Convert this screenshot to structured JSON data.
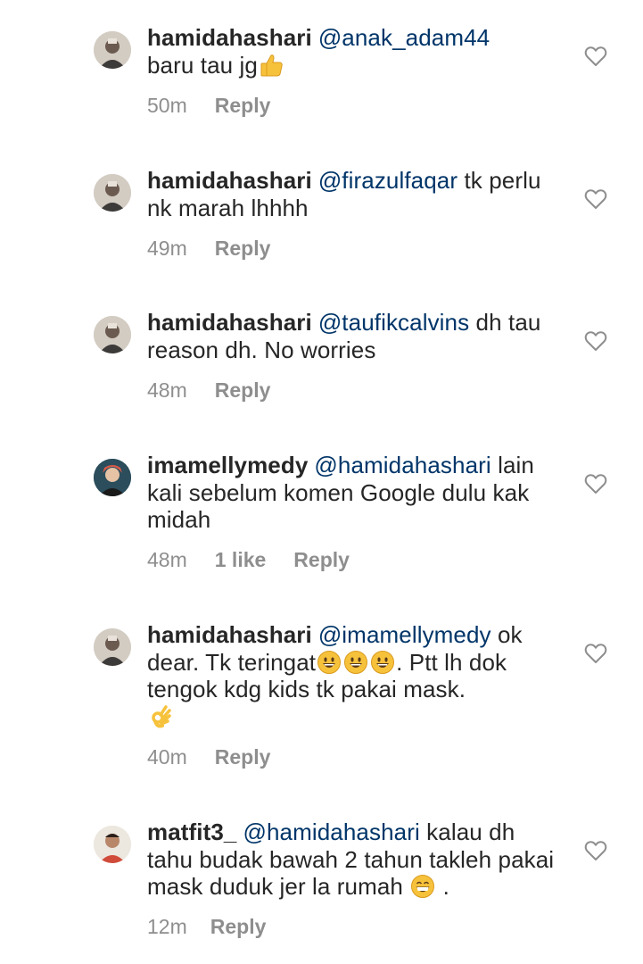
{
  "comments": [
    {
      "username": "hamidahashari",
      "mention": "@anak_adam44",
      "text_before_emoji": " baru tau jg",
      "emojis": [
        "thumbs-up"
      ],
      "text_after": "",
      "time": "50m",
      "likes": "",
      "reply": "Reply"
    },
    {
      "username": "hamidahashari",
      "mention": "@firazulfaqar",
      "text_before_emoji": " tk perlu nk marah lhhhh",
      "emojis": [],
      "text_after": "",
      "time": "49m",
      "likes": "",
      "reply": "Reply"
    },
    {
      "username": "hamidahashari",
      "mention": "@taufikcalvins",
      "text_before_emoji": " dh tau reason dh. No worries",
      "emojis": [],
      "text_after": "",
      "time": "48m",
      "likes": "",
      "reply": "Reply"
    },
    {
      "username": "imamellymedy",
      "mention": "@hamidahashari",
      "text_before_emoji": " lain kali sebelum komen Google dulu kak midah",
      "emojis": [],
      "text_after": "",
      "time": "48m",
      "likes": "1 like",
      "reply": "Reply"
    },
    {
      "username": "hamidahashari",
      "mention": "@imamellymedy",
      "text_before_emoji": " ok dear. Tk teringat",
      "emojis": [
        "grinning",
        "grinning",
        "grinning"
      ],
      "text_after": ". Ptt lh dok tengok kdg kids tk pakai mask.",
      "trailing_emoji": "ok-hand",
      "time": "40m",
      "likes": "",
      "reply": "Reply"
    },
    {
      "username": "matfit3_",
      "mention": "@hamidahashari",
      "text_before_emoji": " kalau dh tahu budak bawah 2 tahun takleh pakai mask duduk jer la rumah",
      "emojis": [
        "beaming"
      ],
      "text_after": " .",
      "time": "12m",
      "likes": "",
      "reply": "Reply"
    }
  ],
  "icons": {
    "like": "heart-outline-icon"
  },
  "colors": {
    "text": "#262626",
    "mention": "#003569",
    "meta": "#8e8e8e",
    "emoji_face": "#f7c23b"
  }
}
